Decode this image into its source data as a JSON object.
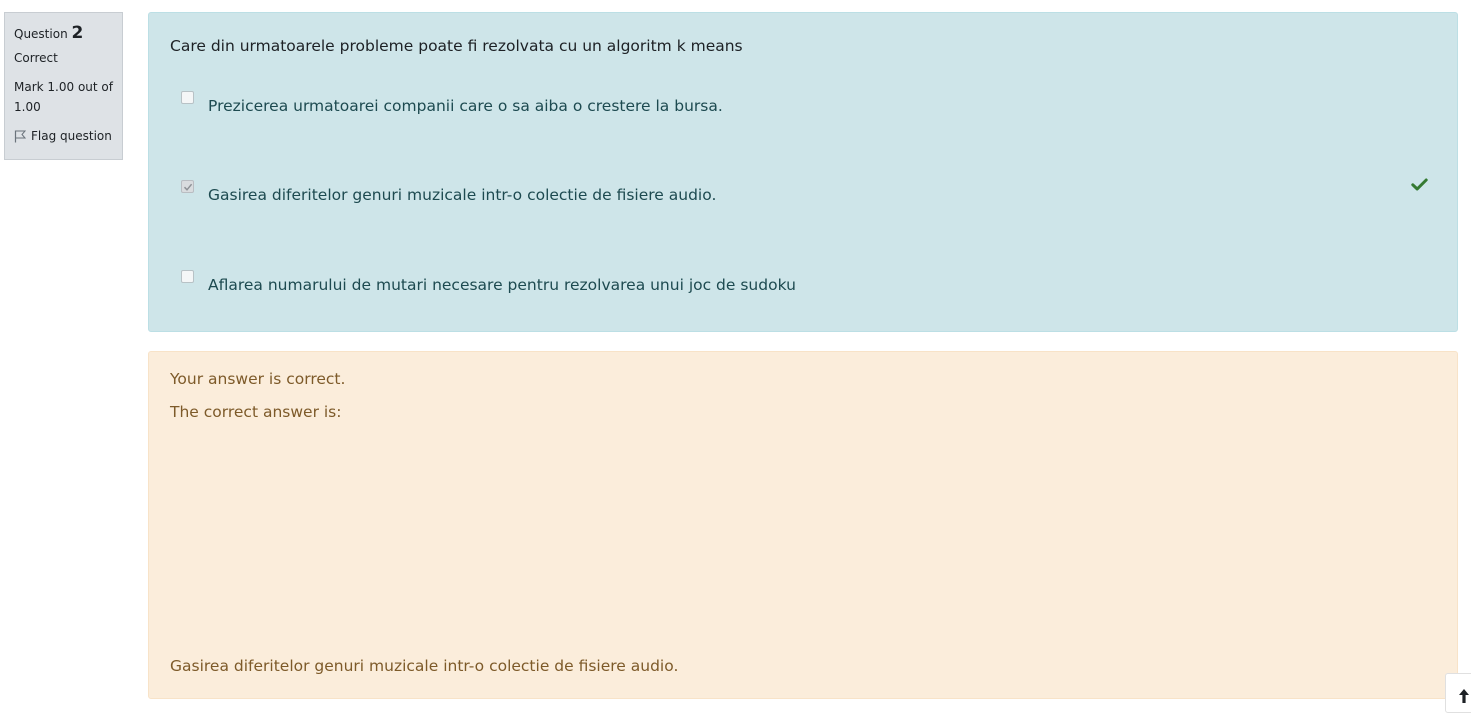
{
  "question_info": {
    "prefix": "Question",
    "number": "2",
    "state": "Correct",
    "grade": "Mark 1.00 out of 1.00",
    "flag_label": "Flag question",
    "flag_icon": "flag-outline-icon"
  },
  "formulation": {
    "question_text": "Care din urmatoarele probleme poate fi rezolvata cu un algoritm k means",
    "options": [
      {
        "label": "Prezicerea urmatoarei companii care o sa aiba o crestere la bursa.",
        "checked": false
      },
      {
        "label": "Gasirea diferitelor genuri muzicale intr-o colectie de fisiere audio.",
        "checked": true,
        "correct_icon": "check-icon"
      },
      {
        "label": "Aflarea numarului de mutari necesare pentru rezolvarea unui joc de sudoku",
        "checked": false
      }
    ],
    "background_color": "#cee5e9",
    "correct_color": "#357a32"
  },
  "outcome": {
    "specific_feedback": "Your answer is correct.",
    "right_answer_intro": "The correct answer is:",
    "right_answer": "Gasirea diferitelor genuri muzicale intr-o colectie de fisiere audio.",
    "background_color": "#fbeddb",
    "text_color": "#7d5a29"
  },
  "back_to_top_icon": "arrow-up-icon"
}
